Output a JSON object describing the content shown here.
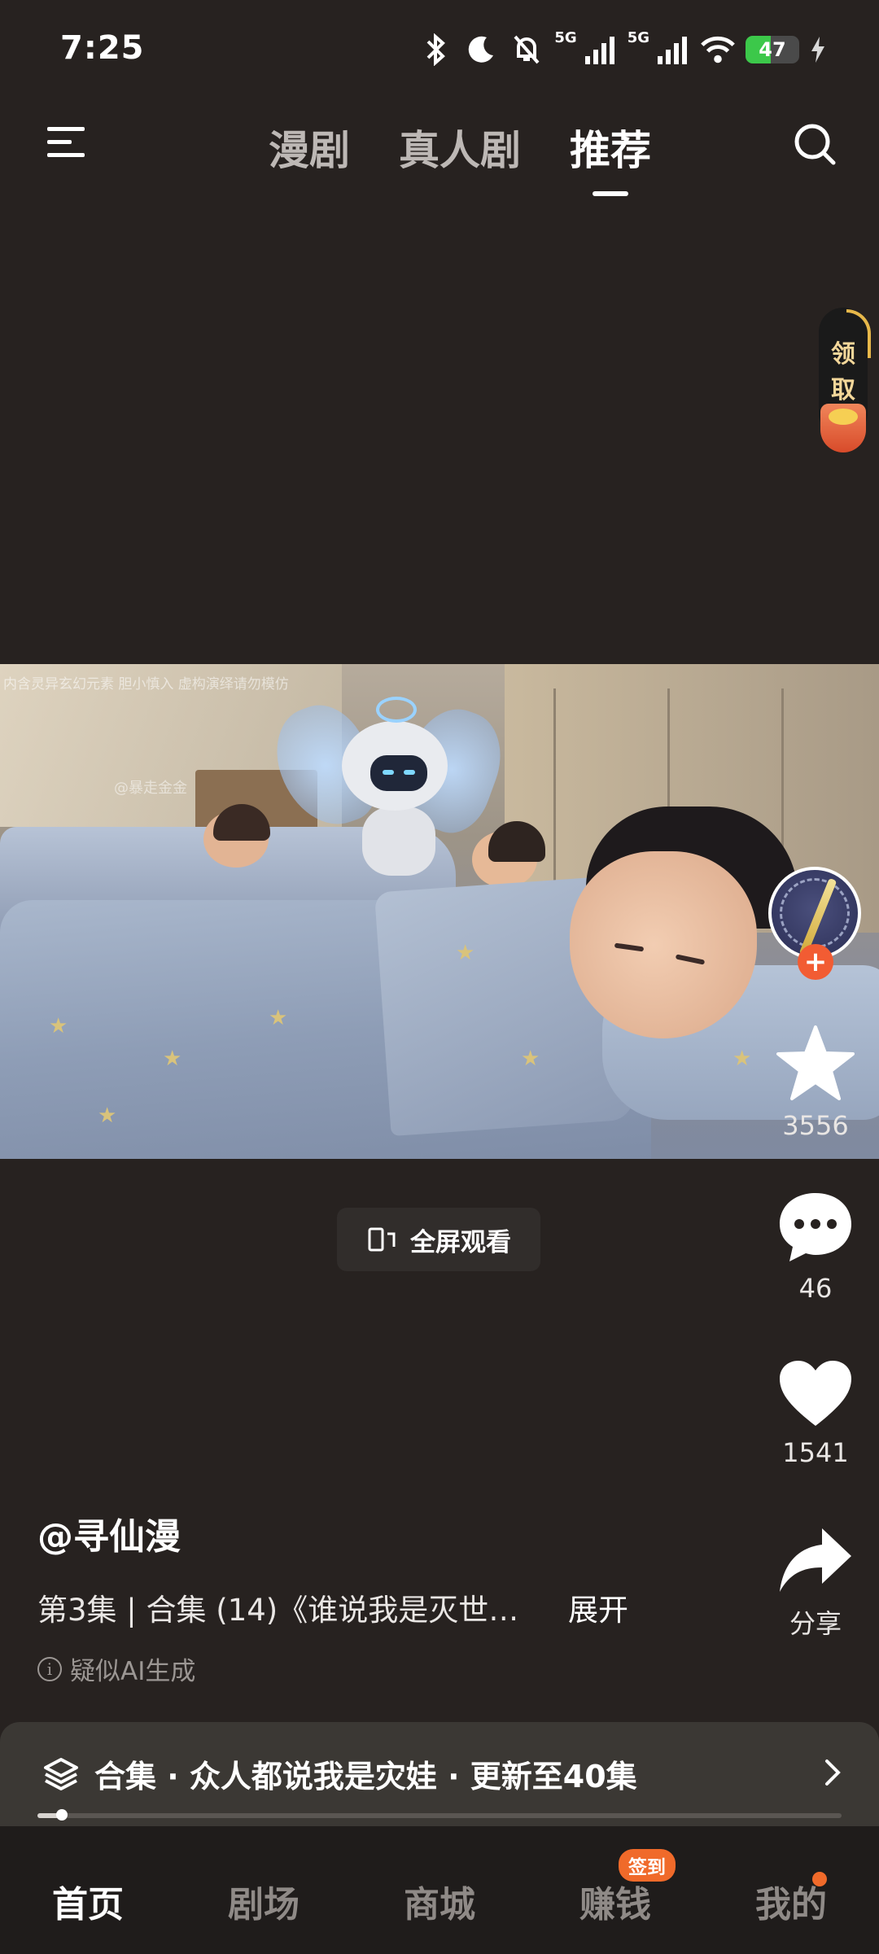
{
  "status_bar": {
    "time": "7:25",
    "network_labels": [
      "5G",
      "5G"
    ],
    "battery_level": "47",
    "icons": [
      "bluetooth-icon",
      "moon-icon",
      "bell-off-icon",
      "signal-icon",
      "signal-icon",
      "wifi-icon",
      "battery-icon",
      "charging-icon"
    ]
  },
  "top_nav": {
    "tabs": [
      {
        "label": "漫剧"
      },
      {
        "label": "真人剧"
      },
      {
        "label": "推荐"
      }
    ],
    "active_tab": "推荐"
  },
  "reward": {
    "line1": "领",
    "line2": "取"
  },
  "video": {
    "watermark": "内含灵异玄幻元素 胆小慎入 虚构演绎请勿模仿",
    "handle_watermark": "@暴走金金"
  },
  "fullscreen": {
    "label": "全屏观看"
  },
  "actions": {
    "favorite_count": "3556",
    "comment_count": "46",
    "like_count": "1541",
    "share_label": "分享"
  },
  "caption": {
    "author": "@寻仙漫",
    "description": "第3集 | 合集 (14)《谁说我是灭世…",
    "expand": "展开",
    "ai_note": "疑似AI生成"
  },
  "collection": {
    "text": "合集 · 众人都说我是灾娃 · 更新至40集",
    "progress": 0.03
  },
  "bottom_nav": {
    "items": [
      {
        "label": "首页"
      },
      {
        "label": "剧场"
      },
      {
        "label": "商城"
      },
      {
        "label": "赚钱"
      },
      {
        "label": "我的"
      }
    ],
    "signin_badge": "签到",
    "active": "首页"
  },
  "colors": {
    "background": "#272220",
    "accent": "#f06a2a",
    "battery_green": "#3cc84a"
  }
}
